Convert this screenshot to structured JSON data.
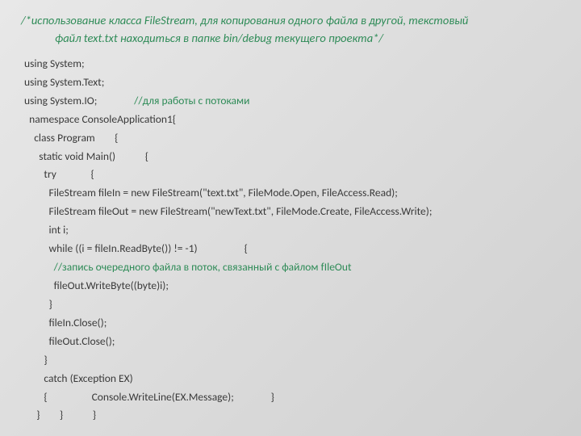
{
  "title_part1": "/*использование класса FileStream, для копирования одного файла в другой, текстовый",
  "title_part2": "файл text.txt находиться в папке bin/debug текущего проекта*/",
  "code": {
    "l01a": "using System;",
    "l02a": "using System.Text;",
    "l03a": "using System.IO;               ",
    "l03b": "//для работы с потоками",
    "l04a": "  namespace ConsoleApplication1{",
    "l05a": "    class Program        {",
    "l06a": "      static void Main()            {",
    "l07a": "        try              {",
    "l08a": "          FileStream fileIn = new FileStream(\"text.txt\", FileMode.Open, FileAccess.Read);",
    "l09a": "          FileStream fileOut = new FileStream(\"newText.txt\", FileMode.Create, FileAccess.Write);",
    "l10a": "          int i;",
    "l11a": "          while ((i = fileIn.ReadByte()) != -1)                   {",
    "l12a": "            ",
    "l12b": "//запись очередного файла в поток, связанный с файлом fIleOut",
    "l13a": "            fileOut.WriteByte((byte)i);",
    "l14a": "          }",
    "l15a": "          fileIn.Close();",
    "l16a": "          fileOut.Close();",
    "l17a": "        }",
    "l18a": "        catch (Exception EX)",
    "l19a": "        {                  Console.WriteLine(EX.Message);               }",
    "l20a": "     }        }            }"
  }
}
